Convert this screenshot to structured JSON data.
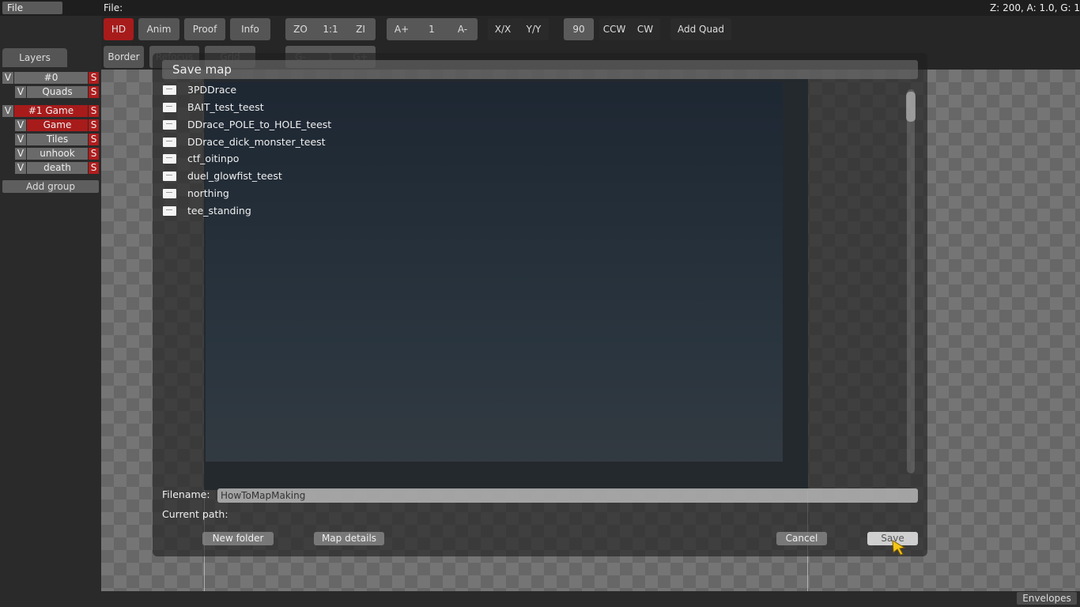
{
  "topbar": {
    "file_menu": "File",
    "file_label": "File:",
    "status": "Z: 200, A: 1.0, G: 1"
  },
  "toolbar": {
    "hd": "HD",
    "anim": "Anim",
    "proof": "Proof",
    "info": "Info",
    "zoom_out": "ZO",
    "zoom_reset": "1:1",
    "zoom_in": "ZI",
    "anim_faster": "A+",
    "anim_value": "1",
    "anim_slower": "A-",
    "flip_x": "X/X",
    "flip_y": "Y/Y",
    "rotate_90": "90",
    "ccw": "CCW",
    "cw": "CW",
    "add_quad": "Add Quad",
    "border": "Border",
    "refocus": "Refocus",
    "grid": "Grid",
    "grid_minus": "G-",
    "grid_value": "1",
    "grid_plus": "G+"
  },
  "layers": {
    "tab": "Layers",
    "visible_toggle": "V",
    "solo_toggle": "S",
    "groups": [
      {
        "name": "#0",
        "layers": [
          "Quads"
        ]
      },
      {
        "name": "#1 Game",
        "layers": [
          "Game",
          "Tiles",
          "unhook",
          "death"
        ]
      }
    ],
    "add_group": "Add group"
  },
  "dialog": {
    "title": "Save map",
    "files": [
      "3PDDrace",
      "BAIT_test_teest",
      "DDrace_POLE_to_HOLE_teest",
      "DDrace_dick_monster_teest",
      "ctf_oitinpo",
      "duel_glowfist_teest",
      "northing",
      "tee_standing"
    ],
    "filename_label": "Filename:",
    "filename_value": "HowToMapMaking",
    "path_label": "Current path:",
    "new_folder": "New folder",
    "map_details": "Map details",
    "cancel": "Cancel",
    "save": "Save"
  },
  "bottombar": {
    "envelopes": "Envelopes"
  },
  "colors": {
    "accent_red": "#a81b1b",
    "panel": "#2a2a2a"
  }
}
